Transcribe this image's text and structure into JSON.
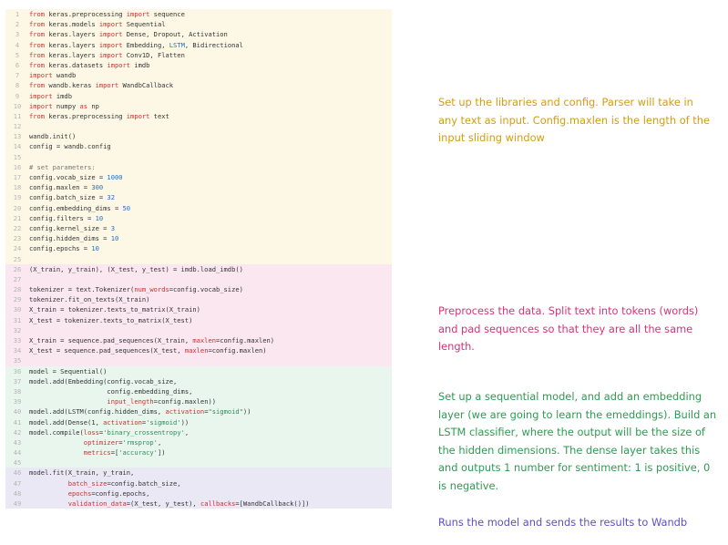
{
  "colors": {
    "block1_bg": "#fdf8e6",
    "block2_bg": "#fbe7f0",
    "block3_bg": "#e8f6ee",
    "block4_bg": "#ebe8f6",
    "note1": "#d59c0f",
    "note2": "#d3347a",
    "note3": "#2f9a52",
    "note4": "#5b4fc9"
  },
  "blocks": [
    {
      "lines": [
        {
          "n": "1",
          "segs": [
            [
              "kw",
              "from"
            ],
            [
              "c",
              " keras.preprocessing "
            ],
            [
              "kw",
              "import"
            ],
            [
              "c",
              " sequence"
            ]
          ]
        },
        {
          "n": "2",
          "segs": [
            [
              "kw",
              "from"
            ],
            [
              "c",
              " keras.models "
            ],
            [
              "kw",
              "import"
            ],
            [
              "c",
              " Sequential"
            ]
          ]
        },
        {
          "n": "3",
          "segs": [
            [
              "kw",
              "from"
            ],
            [
              "c",
              " keras.layers "
            ],
            [
              "kw",
              "import"
            ],
            [
              "c",
              " Dense, Dropout, Activation"
            ]
          ]
        },
        {
          "n": "4",
          "segs": [
            [
              "kw",
              "from"
            ],
            [
              "c",
              " keras.layers "
            ],
            [
              "kw",
              "import"
            ],
            [
              "c",
              " Embedding, "
            ],
            [
              "num",
              "LSTM"
            ],
            [
              "c",
              ", Bidirectional"
            ]
          ]
        },
        {
          "n": "5",
          "segs": [
            [
              "kw",
              "from"
            ],
            [
              "c",
              " keras.layers "
            ],
            [
              "kw",
              "import"
            ],
            [
              "c",
              " Conv1D, Flatten"
            ]
          ]
        },
        {
          "n": "6",
          "segs": [
            [
              "kw",
              "from"
            ],
            [
              "c",
              " keras.datasets "
            ],
            [
              "kw",
              "import"
            ],
            [
              "c",
              " imdb"
            ]
          ]
        },
        {
          "n": "7",
          "segs": [
            [
              "kw",
              "import"
            ],
            [
              "c",
              " wandb"
            ]
          ]
        },
        {
          "n": "8",
          "segs": [
            [
              "kw",
              "from"
            ],
            [
              "c",
              " wandb.keras "
            ],
            [
              "kw",
              "import"
            ],
            [
              "c",
              " WandbCallback"
            ]
          ]
        },
        {
          "n": "9",
          "segs": [
            [
              "kw",
              "import"
            ],
            [
              "c",
              " imdb"
            ]
          ]
        },
        {
          "n": "10",
          "segs": [
            [
              "kw",
              "import"
            ],
            [
              "c",
              " numpy "
            ],
            [
              "kw",
              "as"
            ],
            [
              "c",
              " np"
            ]
          ]
        },
        {
          "n": "11",
          "segs": [
            [
              "kw",
              "from"
            ],
            [
              "c",
              " keras.preprocessing "
            ],
            [
              "kw",
              "import"
            ],
            [
              "c",
              " text"
            ]
          ]
        },
        {
          "n": "12",
          "segs": []
        },
        {
          "n": "13",
          "segs": [
            [
              "c",
              "wandb.init()"
            ]
          ]
        },
        {
          "n": "14",
          "segs": [
            [
              "c",
              "config = wandb.config"
            ]
          ]
        },
        {
          "n": "15",
          "segs": []
        },
        {
          "n": "16",
          "segs": [
            [
              "cmt",
              "# set parameters:"
            ]
          ]
        },
        {
          "n": "17",
          "segs": [
            [
              "c",
              "config.vocab_size = "
            ],
            [
              "num",
              "1000"
            ]
          ]
        },
        {
          "n": "18",
          "segs": [
            [
              "c",
              "config.maxlen = "
            ],
            [
              "num",
              "300"
            ]
          ]
        },
        {
          "n": "19",
          "segs": [
            [
              "c",
              "config.batch_size = "
            ],
            [
              "num",
              "32"
            ]
          ]
        },
        {
          "n": "20",
          "segs": [
            [
              "c",
              "config.embedding_dims = "
            ],
            [
              "num",
              "50"
            ]
          ]
        },
        {
          "n": "21",
          "segs": [
            [
              "c",
              "config.filters = "
            ],
            [
              "num",
              "10"
            ]
          ]
        },
        {
          "n": "22",
          "segs": [
            [
              "c",
              "config.kernel_size = "
            ],
            [
              "num",
              "3"
            ]
          ]
        },
        {
          "n": "23",
          "segs": [
            [
              "c",
              "config.hidden_dims = "
            ],
            [
              "num",
              "10"
            ]
          ]
        },
        {
          "n": "24",
          "segs": [
            [
              "c",
              "config.epochs = "
            ],
            [
              "num",
              "10"
            ]
          ]
        },
        {
          "n": "25",
          "segs": []
        }
      ]
    },
    {
      "lines": [
        {
          "n": "26",
          "segs": [
            [
              "c",
              "(X_train, y_train), (X_test, y_test) = imdb.load_imdb()"
            ]
          ]
        },
        {
          "n": "27",
          "segs": []
        },
        {
          "n": "28",
          "segs": [
            [
              "c",
              "tokenizer = text.Tokenizer("
            ],
            [
              "kw",
              "num_words"
            ],
            [
              "c",
              "=config.vocab_size)"
            ]
          ]
        },
        {
          "n": "29",
          "segs": [
            [
              "c",
              "tokenizer.fit_on_texts(X_train)"
            ]
          ]
        },
        {
          "n": "30",
          "segs": [
            [
              "c",
              "X_train = tokenizer.texts_to_matrix(X_train)"
            ]
          ]
        },
        {
          "n": "31",
          "segs": [
            [
              "c",
              "X_test = tokenizer.texts_to_matrix(X_test)"
            ]
          ]
        },
        {
          "n": "32",
          "segs": []
        },
        {
          "n": "33",
          "segs": [
            [
              "c",
              "X_train = sequence.pad_sequences(X_train, "
            ],
            [
              "kw",
              "maxlen"
            ],
            [
              "c",
              "=config.maxlen)"
            ]
          ]
        },
        {
          "n": "34",
          "segs": [
            [
              "c",
              "X_test = sequence.pad_sequences(X_test, "
            ],
            [
              "kw",
              "maxlen"
            ],
            [
              "c",
              "=config.maxlen)"
            ]
          ]
        },
        {
          "n": "35",
          "segs": []
        }
      ]
    },
    {
      "lines": [
        {
          "n": "36",
          "segs": [
            [
              "c",
              "model = Sequential()"
            ]
          ]
        },
        {
          "n": "37",
          "segs": [
            [
              "c",
              "model.add(Embedding(config.vocab_size,"
            ]
          ]
        },
        {
          "n": "38",
          "segs": [
            [
              "c",
              "                    config.embedding_dims,"
            ]
          ]
        },
        {
          "n": "39",
          "segs": [
            [
              "c",
              "                    "
            ],
            [
              "kw",
              "input_length"
            ],
            [
              "c",
              "=config.maxlen))"
            ]
          ]
        },
        {
          "n": "40",
          "segs": [
            [
              "c",
              "model.add(LSTM(config.hidden_dims, "
            ],
            [
              "kw",
              "activation"
            ],
            [
              "c",
              "="
            ],
            [
              "str",
              "\"sigmoid\""
            ],
            [
              "c",
              "))"
            ]
          ]
        },
        {
          "n": "41",
          "segs": [
            [
              "c",
              "model.add(Dense(1, "
            ],
            [
              "kw",
              "activation"
            ],
            [
              "c",
              "="
            ],
            [
              "str",
              "'sigmoid'"
            ],
            [
              "c",
              "))"
            ]
          ]
        },
        {
          "n": "42",
          "segs": [
            [
              "c",
              "model.compile("
            ],
            [
              "kw",
              "loss"
            ],
            [
              "c",
              "="
            ],
            [
              "str",
              "'binary_crossentropy'"
            ],
            [
              "c",
              ","
            ]
          ]
        },
        {
          "n": "43",
          "segs": [
            [
              "c",
              "              "
            ],
            [
              "kw",
              "optimizer"
            ],
            [
              "c",
              "="
            ],
            [
              "str",
              "'rmsprop'"
            ],
            [
              "c",
              ","
            ]
          ]
        },
        {
          "n": "44",
          "segs": [
            [
              "c",
              "              "
            ],
            [
              "kw",
              "metrics"
            ],
            [
              "c",
              "=["
            ],
            [
              "str",
              "'accuracy'"
            ],
            [
              "c",
              "])"
            ]
          ]
        },
        {
          "n": "45",
          "segs": []
        }
      ]
    },
    {
      "lines": [
        {
          "n": "46",
          "segs": [
            [
              "c",
              "model.fit(X_train, y_train,"
            ]
          ]
        },
        {
          "n": "47",
          "segs": [
            [
              "c",
              "          "
            ],
            [
              "kw",
              "batch_size"
            ],
            [
              "c",
              "=config.batch_size,"
            ]
          ]
        },
        {
          "n": "48",
          "segs": [
            [
              "c",
              "          "
            ],
            [
              "kw",
              "epochs"
            ],
            [
              "c",
              "=config.epochs,"
            ]
          ]
        },
        {
          "n": "49",
          "segs": [
            [
              "c",
              "          "
            ],
            [
              "kw",
              "validation_data"
            ],
            [
              "c",
              "=(X_test, y_test), "
            ],
            [
              "kw",
              "callbacks"
            ],
            [
              "c",
              "=[WandbCallback()])"
            ]
          ]
        }
      ]
    }
  ],
  "notes": [
    "Set up the libraries and config. Parser will take in any text as input. Config.maxlen is the length of the input sliding window",
    "Preprocess the data. Split text into tokens (words) and pad sequences so that they are all the same length.",
    "Set up a sequential model, and add an embedding layer (we are going to learn the emeddings). Build an LSTM classifier, where the output will be the size of the hidden dimensions. The dense layer takes this and outputs 1 number for sentiment: 1 is positive, 0 is negative.",
    "Runs the model and sends the results to Wandb"
  ]
}
